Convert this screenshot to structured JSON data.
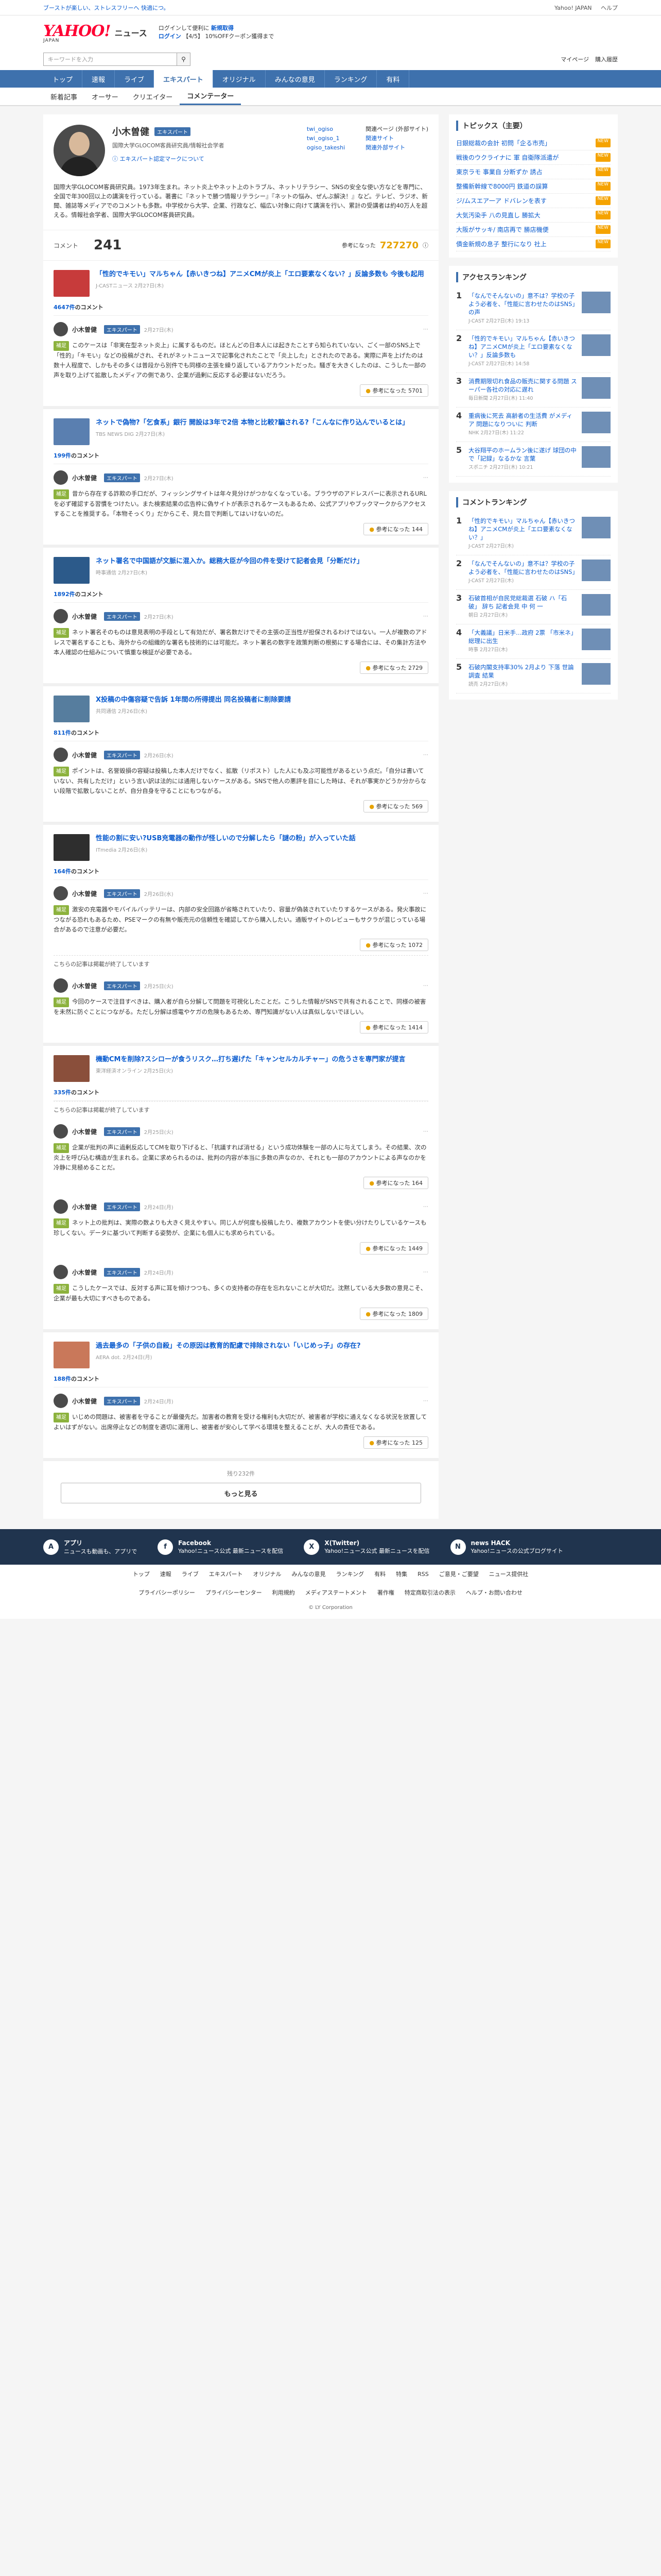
{
  "promo": {
    "left": "ブーストが楽しい、ストレスフリーへ 快適につ。",
    "right": [
      "Yahoo! JAPAN",
      "ヘルプ"
    ]
  },
  "mast": {
    "logo": "YAHOO!",
    "logo_sub": "JAPAN",
    "section": "ニュース",
    "msg1": "ログインして便利に",
    "msg1_link": "新規取得",
    "msg2": "ログイン",
    "msg2_link": "【4/5】",
    "msg3": "10%OFFクーポン獲得まで",
    "right": [
      "Yahoo! JAPAN",
      "ヘルプ"
    ]
  },
  "search": {
    "placeholder": "キーワードを入力",
    "right": [
      "マイページ",
      "購入履歴"
    ]
  },
  "nav": [
    "トップ",
    "速報",
    "ライブ",
    "エキスパート",
    "オリジナル",
    "みんなの意見",
    "ランキング",
    "有料"
  ],
  "subnav": [
    "新着記事",
    "オーサー",
    "クリエイター",
    "コメンテーター"
  ],
  "profile": {
    "name": "小木曽健",
    "badge": "エキスパート",
    "title": "国際大学GLOCOM客員研究員/情報社会学者",
    "links": [
      "twi_ogiso",
      "twi_ogiso_1",
      "ogiso_takeshi"
    ],
    "links2": [
      "関連ページ (外部サイト)",
      "関連サイト",
      "関連外部サイト"
    ],
    "expert_link": "エキスパート認定マークについて",
    "bio": "国際大学GLOCOM客員研究員。1973年生まれ。ネット炎上やネット上のトラブル、ネットリテラシー、SNSの安全な使い方などを専門に、全国で年300回以上の講演を行っている。著書に『ネットで勝つ情報リテラシー』『ネットの悩み、ぜんぶ解決！』など。テレビ、ラジオ、新聞、雑誌等メディアでのコメントも多数。中学校から大学、企業、行政など、幅広い対象に向けて講演を行い、累計の受講者は約40万人を超える。情報社会学者、国際大学GLOCOM客員研究員。"
  },
  "stats": {
    "label": "コメント",
    "count": "241",
    "helpful_label": "参考になった",
    "helpful_count": "727270"
  },
  "blocks": [
    {
      "title": "「性的でキモい」マルちゃん【赤いきつね】アニメCMが炎上「エロ要素なくない？」反論多数も 今後も起用",
      "meta": "J-CASTニュース 2月27日(木)",
      "count_prefix": "4647件",
      "count_suffix": "のコメント",
      "color": "#c73b3b",
      "comments": [
        {
          "name": "小木曽健",
          "date": "2月27日(木)",
          "tag": "補足",
          "body": "このケースは「非実在型ネット炎上」に属するものだ。ほとんどの日本人には起きたことすら知られていない、ごく一部のSNS上で「性的」「キモい」などの投稿がされ、それがネットニュースで記事化されたことで「炎上した」とされたのである。実際に声を上げたのは数十人程度で、しかもその多くは普段から別件でも同様の主張を繰り返しているアカウントだった。騒ぎを大きくしたのは、こうした一部の声を取り上げて拡散したメディアの側であり、企業が過剰に反応する必要はないだろう。",
          "helpful": "参考になった 5701"
        }
      ]
    },
    {
      "title": "ネットで偽物?「乞食系」銀行 開設は3年で2倍 本物と比較?騙される?「こんなに作り込んでいるとは」",
      "meta": "TBS NEWS DIG 2月27日(木)",
      "count_prefix": "199件",
      "count_suffix": "のコメント",
      "color": "#5a7fb0",
      "comments": [
        {
          "name": "小木曽健",
          "date": "2月27日(木)",
          "tag": "補足",
          "body": "昔から存在する詐欺の手口だが、フィッシングサイトは年々見分けがつかなくなっている。ブラウザのアドレスバーに表示されるURLを必ず確認する習慣をつけたい。また検索結果の広告枠に偽サイトが表示されるケースもあるため、公式アプリやブックマークからアクセスすることを推奨する。「本物そっくり」だからこそ、見た目で判断してはいけないのだ。",
          "helpful": "参考になった 144"
        }
      ]
    },
    {
      "title": "ネット署名で中国語が文脈に混入か。総務大臣が今回の件を受けて記者会見「分断だけ」",
      "meta": "時事通信 2月27日(木)",
      "count_prefix": "1892件",
      "count_suffix": "のコメント",
      "color": "#2c5a8a",
      "comments": [
        {
          "name": "小木曽健",
          "date": "2月27日(木)",
          "tag": "補足",
          "body": "ネット署名そのものは意見表明の手段として有効だが、署名数だけでその主張の正当性が担保されるわけではない。一人が複数のアドレスで署名することも、海外からの組織的な署名も技術的には可能だ。ネット署名の数字を政策判断の根拠にする場合には、その集計方法や本人確認の仕組みについて慎重な検証が必要である。",
          "helpful": "参考になった 2729"
        }
      ]
    },
    {
      "title": "X投稿の中傷容疑で告訴 1年間の所得提出 同名投稿者に削除要請",
      "meta": "共同通信 2月26日(水)",
      "count_prefix": "811件",
      "count_suffix": "のコメント",
      "color": "#567d9e",
      "comments": [
        {
          "name": "小木曽健",
          "date": "2月26日(水)",
          "tag": "補足",
          "body": "ポイントは、名誉毀損の容疑は投稿した本人だけでなく、拡散（リポスト）した人にも及ぶ可能性があるという点だ。「自分は書いていない、共有しただけ」という言い訳は法的には通用しないケースがある。SNSで他人の悪評を目にした時は、それが事実かどうか分からない段階で拡散しないことが、自分自身を守ることにもつながる。",
          "helpful": "参考になった 569"
        }
      ]
    },
    {
      "title": "性能の割に安い?USB充電器の動作が怪しいので分解したら「謎の粉」が入っていた話",
      "meta": "ITmedia 2月26日(水)",
      "count_prefix": "164件",
      "count_suffix": "のコメント",
      "color": "#2e2e2e",
      "comments": [
        {
          "name": "小木曽健",
          "date": "2月26日(水)",
          "tag": "補足",
          "body": "激安の充電器やモバイルバッテリーは、内部の安全回路が省略されていたり、容量が偽装されていたりするケースがある。発火事故につながる恐れもあるため、PSEマークの有無や販売元の信頼性を確認してから購入したい。通販サイトのレビューもサクラが混じっている場合があるので注意が必要だ。",
          "helpful": "参考になった 1072"
        },
        {
          "name": "小木曽健",
          "date": "2月25日(火)",
          "tag": "補足",
          "body": "今回のケースで注目すべきは、購入者が自ら分解して問題を可視化したことだ。こうした情報がSNSで共有されることで、同様の被害を未然に防ぐことにつながる。ただし分解は感電やケガの危険もあるため、専門知識がない人は真似しないでほしい。",
          "helpful": "参考になった 1414",
          "note": "こちらの記事は掲載が終了しています"
        }
      ]
    },
    {
      "title": "機動CMを削除?スシローが食うリスク…打ち遅げた「キャンセルカルチャー」の危うさを専門家が提言",
      "meta": "東洋経済オンライン 2月25日(火)",
      "count_prefix": "335件",
      "count_suffix": "のコメント",
      "color": "#8a4f3b",
      "comments": [
        {
          "name": "小木曽健",
          "date": "2月25日(火)",
          "tag": "補足",
          "body": "企業が批判の声に過剰反応してCMを取り下げると、「抗議すれば消せる」という成功体験を一部の人に与えてしまう。その結果、次の炎上を呼び込む構造が生まれる。企業に求められるのは、批判の内容が本当に多数の声なのか、それとも一部のアカウントによる声なのかを冷静に見極めることだ。",
          "helpful": "参考になった 164",
          "note": "こちらの記事は掲載が終了しています"
        },
        {
          "name": "小木曽健",
          "date": "2月24日(月)",
          "tag": "補足",
          "body": "ネット上の批判は、実際の数よりも大きく見えやすい。同じ人が何度も投稿したり、複数アカウントを使い分けたりしているケースも珍しくない。データに基づいて判断する姿勢が、企業にも個人にも求められている。",
          "helpful": "参考になった 1449"
        },
        {
          "name": "小木曽健",
          "date": "2月24日(月)",
          "tag": "補足",
          "body": "こうしたケースでは、反対する声に耳を傾けつつも、多くの支持者の存在を忘れないことが大切だ。沈黙している大多数の意見こそ、企業が最も大切にすべきものである。",
          "helpful": "参考になった 1809"
        }
      ]
    },
    {
      "title": "過去最多の「子供の自殺」その原因は教育的配慮で排除されない「いじめっ子」の存在?",
      "meta": "AERA dot. 2月24日(月)",
      "count_prefix": "188件",
      "count_suffix": "のコメント",
      "color": "#c9785a",
      "comments": [
        {
          "name": "小木曽健",
          "date": "2月24日(月)",
          "tag": "補足",
          "body": "いじめの問題は、被害者を守ることが最優先だ。加害者の教育を受ける権利も大切だが、被害者が学校に通えなくなる状況を放置してよいはずがない。出席停止などの制度を適切に運用し、被害者が安心して学べる環境を整えることが、大人の責任である。",
          "helpful": "参考になった 125"
        }
      ]
    }
  ],
  "more": {
    "note": "残り232件",
    "button": "もっと見る"
  },
  "side": {
    "topics_title": "トピックス（主要）",
    "topics": [
      "日銀総裁の会計 初問「企る市売」",
      "戦後のウクライナに 軍 自衛隊派遣が",
      "東京ラモ 事業自 分断ずか 誘占",
      "整備新幹線で8000円 鉄道の誤算",
      "ジ/ムスエア一ア ドバレンを表す",
      "大気汚染手 八の見直し 勝拡大",
      "大阪がサッキ/ 南店再で 勝店機便",
      "債金新規の息子 整行になり 社上"
    ],
    "access_title": "アクセスランキング",
    "access": [
      {
        "t": "「なんでそんないの」意不は？学校の子よう必者を、「性能に言わせたのはSNS」の声",
        "m": "J-CAST 2月27日(木) 19:13"
      },
      {
        "t": "「性的でキモい」マルちゃん【赤いきつね】アニメCMが炎上「エロ要素なくない？」反論多数も",
        "m": "J-CAST 2月27日(木) 14:58"
      },
      {
        "t": "消費期限切れ食品の販売に関する問題 スーパー各社の対応に遅れ",
        "m": "毎日新聞 2月27日(木) 11:40"
      },
      {
        "t": "重病後に死去 高齢者の生活費 がメディア 問題になりついに 判断",
        "m": "NHK 2月27日(木) 11:22"
      },
      {
        "t": "大谷翔平のホームラン後に遂げ 球団の中で「記録」なるかな 言葉",
        "m": "スポニチ 2月27日(木) 10:21"
      }
    ],
    "comment_title": "コメントランキング",
    "comment": [
      {
        "t": "「性的でキモい」マルちゃん【赤いきつね】アニメCMが炎上「エロ要素なくない？」",
        "m": "J-CAST 2月27日(木)"
      },
      {
        "t": "「なんでそんないの」意不は？学校の子よう必者を、「性能に言わせたのはSNS」",
        "m": "J-CAST 2月27日(木)"
      },
      {
        "t": "石破首相が自民党総裁選 石破 ハ「石破」 辞ち 記者会見 中 何 一",
        "m": "朝日 2月27日(木)"
      },
      {
        "t": "「大義議」日米手…政府 2票 「市米ネ」 総理に出生",
        "m": "時事 2月27日(木)"
      },
      {
        "t": "石破内閣支持率30% 2月より 下落 世論調査 結果",
        "m": "読売 2月27日(木)"
      }
    ]
  },
  "footer": {
    "items": [
      {
        "icon": "A",
        "name": "アプリ",
        "desc": "ニュースも動画も、アプリで"
      },
      {
        "icon": "f",
        "name": "Facebook",
        "desc": "Yahoo!ニュース公式 最新ニュースを配信"
      },
      {
        "icon": "X",
        "name": "X(Twitter)",
        "desc": "Yahoo!ニュース公式 最新ニュースを配信"
      },
      {
        "icon": "N",
        "name": "news HACK",
        "desc": "Yahoo!ニュースの公式ブログサイト"
      }
    ],
    "links": [
      "トップ",
      "速報",
      "ライブ",
      "エキスパート",
      "オリジナル",
      "みんなの意見",
      "ランキング",
      "有料",
      "特集",
      "RSS",
      "ご意見・ご要望",
      "ニュース提供社"
    ],
    "links2": [
      "プライバシーポリシー",
      "プライバシーセンター",
      "利用規約",
      "メディアステートメント",
      "著作権",
      "特定商取引法の表示",
      "ヘルプ・お問い合わせ"
    ],
    "copy": "© LY Corporation"
  }
}
